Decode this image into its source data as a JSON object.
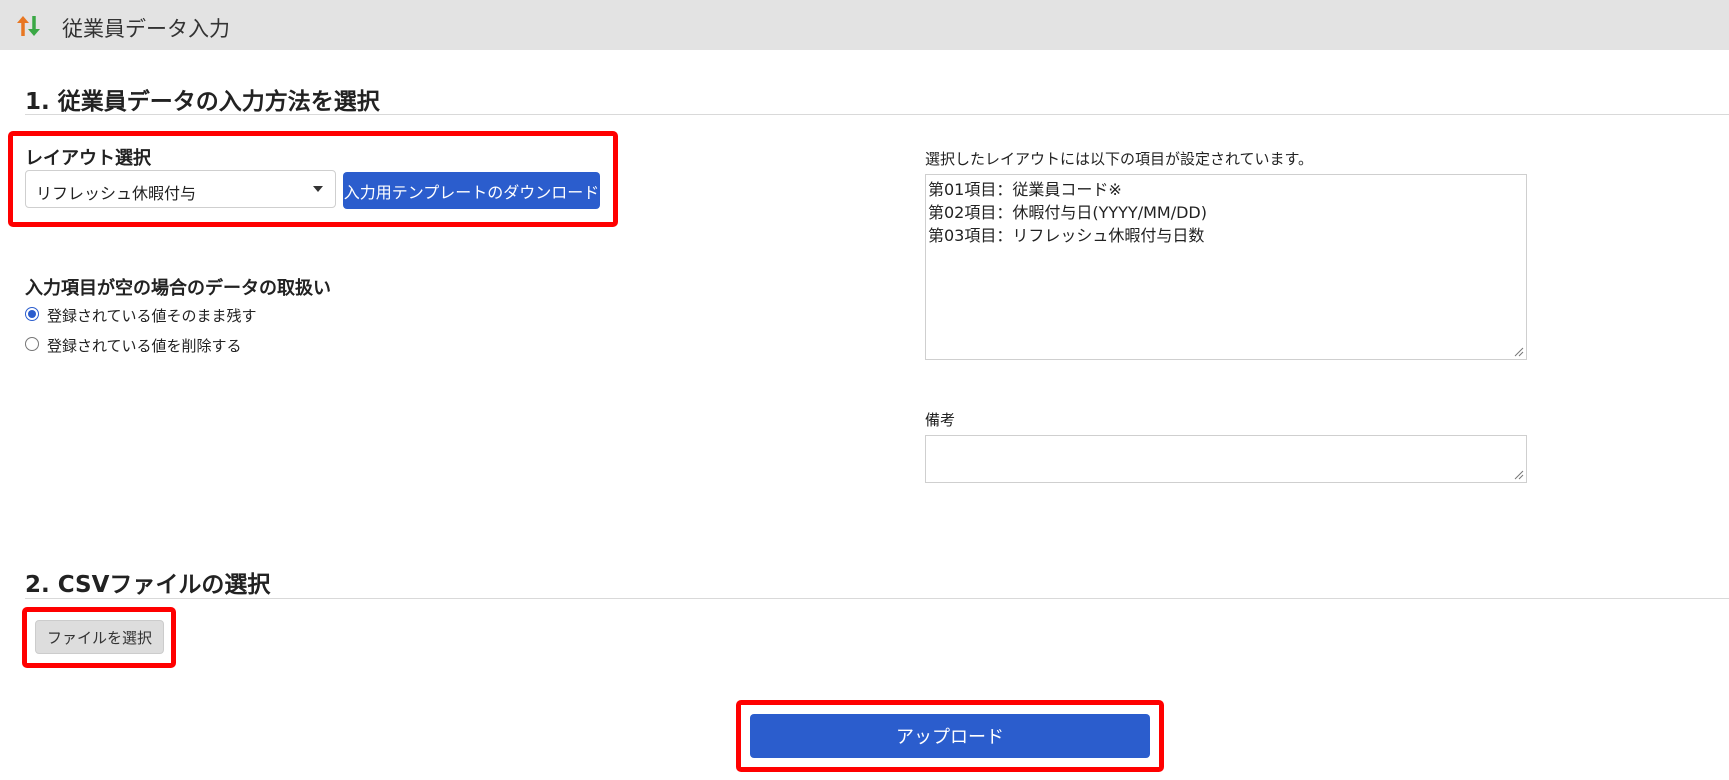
{
  "window": {
    "title": "従業員データ入力",
    "icon": "sort-arrows-icon"
  },
  "section1": {
    "heading": "1. 従業員データの入力方法を選択",
    "layout_label": "レイアウト選択",
    "layout_selected": "リフレッシュ休暇付与",
    "download_button": "入力用テンプレートのダウンロード",
    "empty_handling_label": "入力項目が空の場合のデータの取扱い",
    "radio_options": [
      {
        "label": "登録されている値そのまま残す",
        "checked": true
      },
      {
        "label": "登録されている値を削除する",
        "checked": false
      }
    ],
    "fields_caption": "選択したレイアウトには以下の項目が設定されています。",
    "fields": [
      "第01項目：従業員コード※",
      "第02項目：休暇付与日(YYYY/MM/DD)",
      "第03項目：リフレッシュ休暇付与日数"
    ],
    "notes_label": "備考",
    "notes_value": ""
  },
  "section2": {
    "heading": "2. CSVファイルの選択",
    "file_button": "ファイルを選択"
  },
  "upload_button": "アップロード",
  "colors": {
    "primary": "#2b5dcd",
    "highlight": "#ff0000",
    "titlebar": "#e3e3e3"
  }
}
